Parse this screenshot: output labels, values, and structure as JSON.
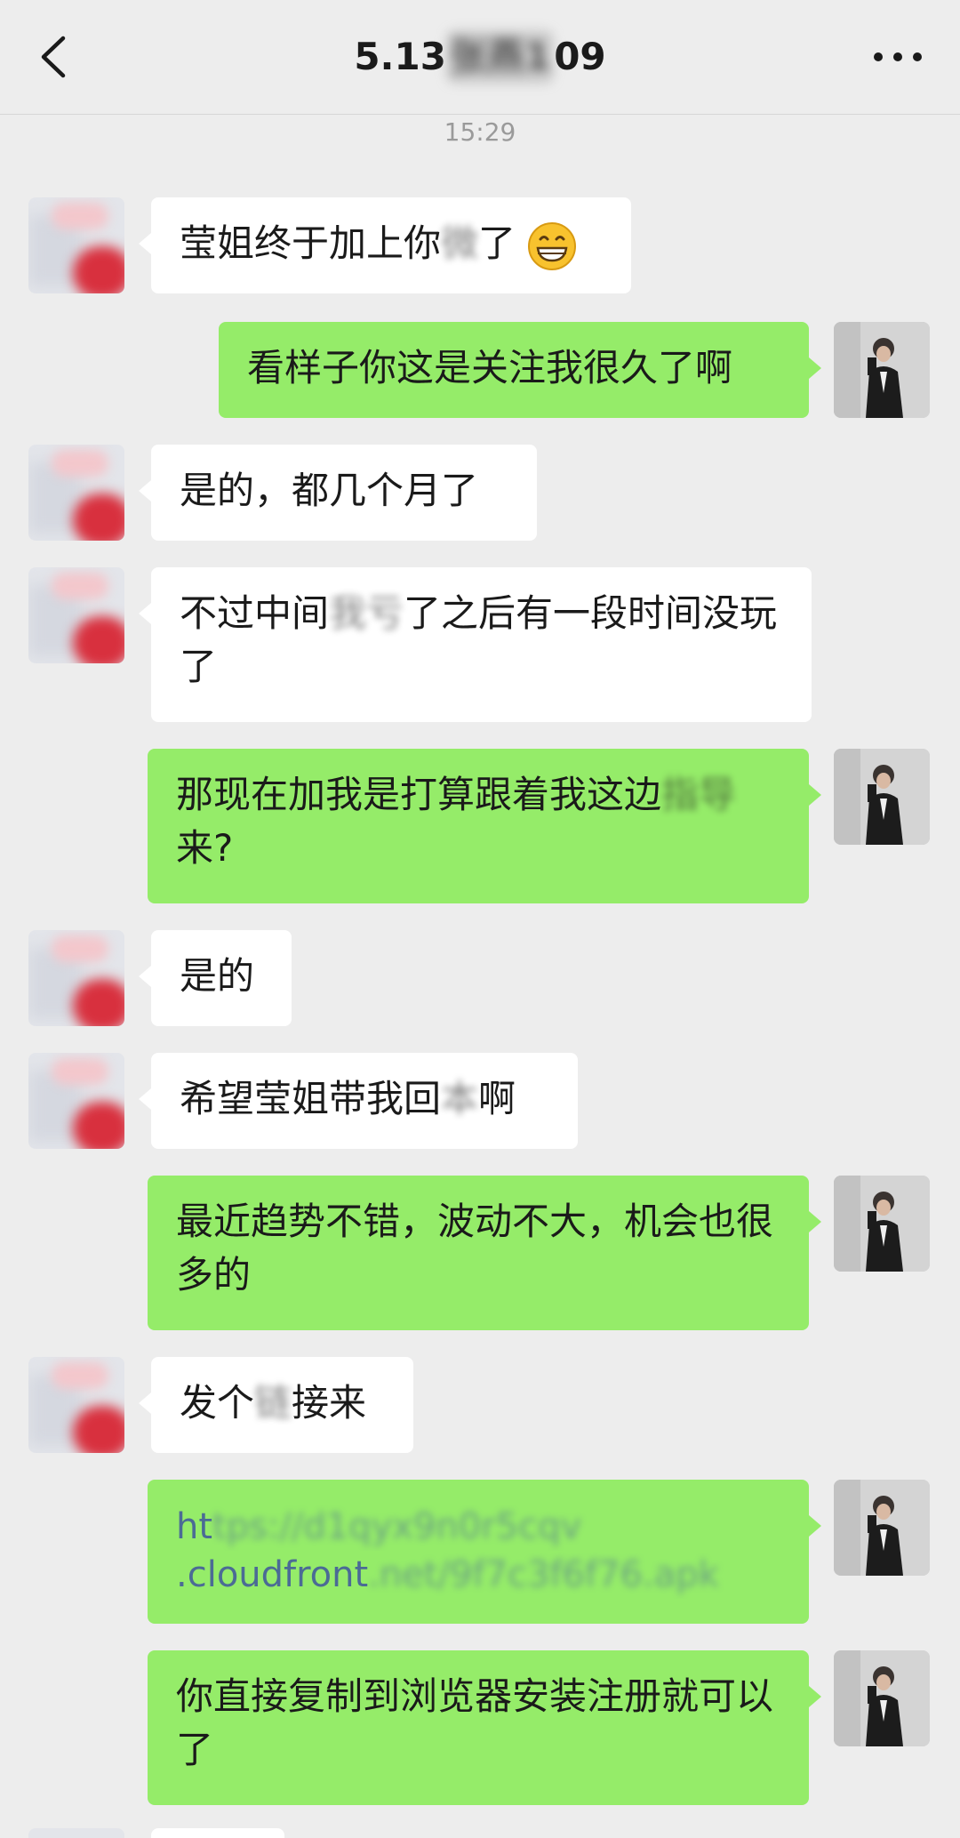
{
  "header": {
    "title_prefix": "5.13",
    "title_blurred": "张燕1",
    "title_suffix": "09",
    "back_icon": "chevron-left-icon",
    "more_icon": "more-dots-icon"
  },
  "timestamp": "15:29",
  "messages": [
    {
      "side": "in",
      "pre": "莹姐终于加上你",
      "blur": "微",
      "post": "了",
      "emoji": "grinning-face-icon"
    },
    {
      "side": "out",
      "pre": "看样子你这是关注我很久了啊",
      "blur": "",
      "post": ""
    },
    {
      "side": "in",
      "pre": "是的，都几个月了",
      "blur": "",
      "post": ""
    },
    {
      "side": "in",
      "pre": "不过中间",
      "blur": "我亏",
      "post": "了之后有一段时间没玩了"
    },
    {
      "side": "out",
      "pre": "那现在加我是打算跟着我这边",
      "blur": "指导",
      "post": "来?"
    },
    {
      "side": "in",
      "pre": "是的",
      "blur": "",
      "post": ""
    },
    {
      "side": "in",
      "pre": "希望莹姐带我回",
      "blur": "本",
      "post": "啊"
    },
    {
      "side": "out",
      "pre": "最近趋势不错，波动不大，机会也很多的",
      "blur": "",
      "post": ""
    },
    {
      "side": "in",
      "pre": "发个",
      "blur": "链",
      "post": "接来"
    },
    {
      "side": "out",
      "pre": "ht",
      "blur": "tps://d1qyx9n0r5cqv",
      "post": "",
      "line2_pre": ".cloudfront",
      "line2_blur": ".net/9f7c3f6f76.apk"
    },
    {
      "side": "out",
      "pre": "你直接复制到浏览器安装注册就可以了",
      "blur": "",
      "post": ""
    }
  ]
}
